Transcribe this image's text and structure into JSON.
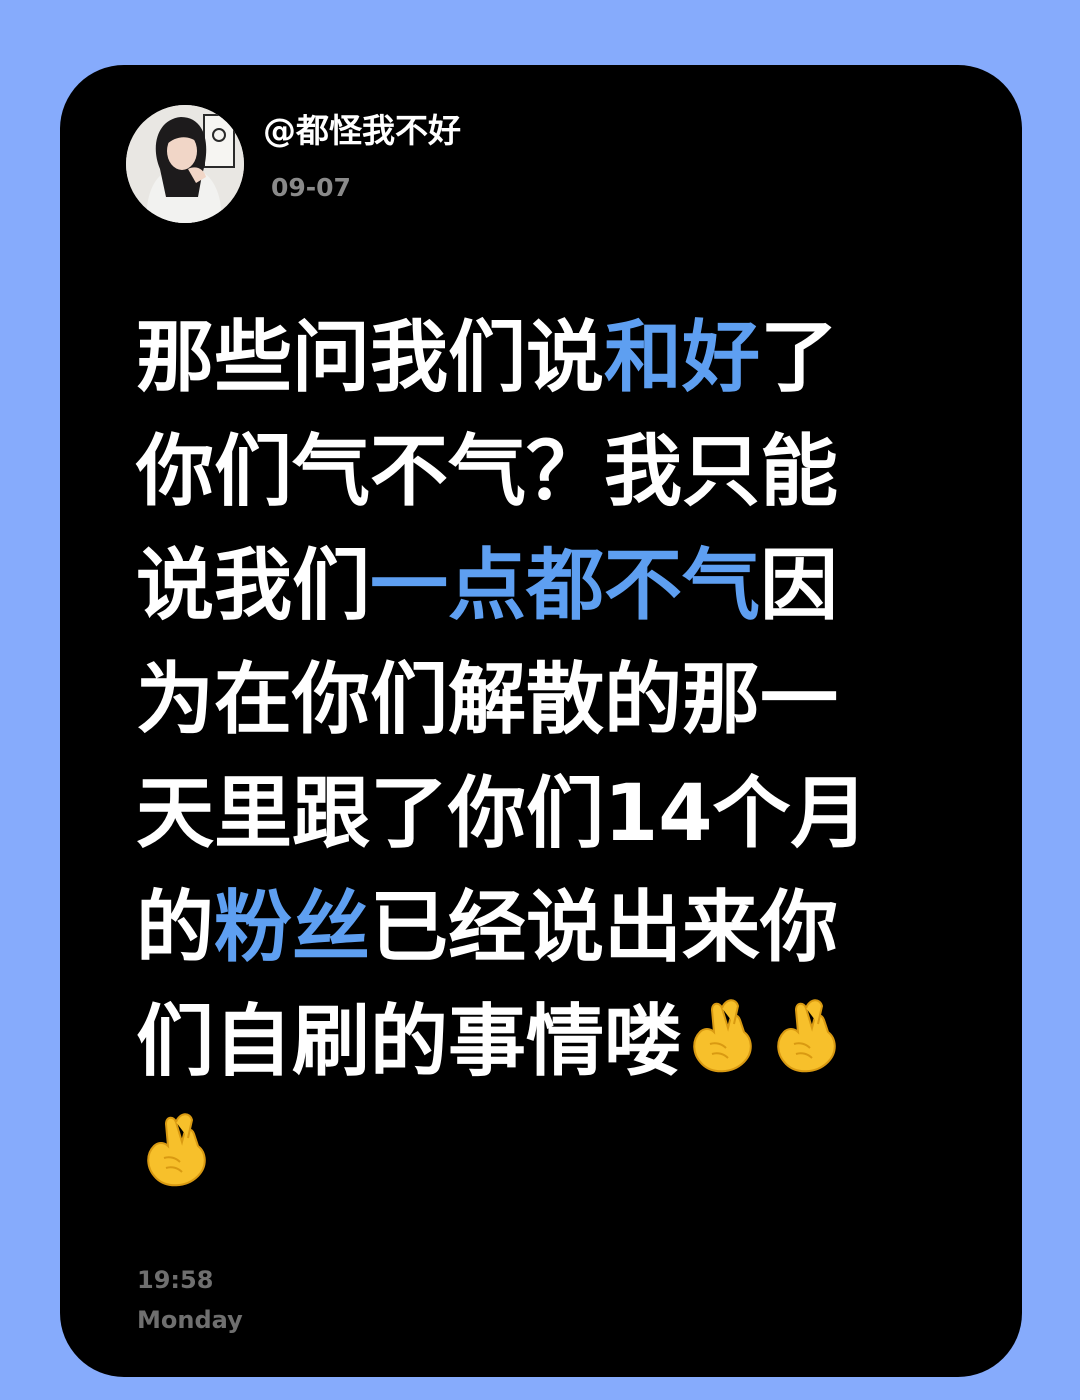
{
  "post": {
    "username": "@都怪我不好",
    "date": "09-07",
    "lines": [
      [
        {
          "text": "那些问我们说"
        },
        {
          "text": "和好",
          "hl": true
        },
        {
          "text": "了"
        }
      ],
      [
        {
          "text": "你们气不气？我只能"
        }
      ],
      [
        {
          "text": "说我们"
        },
        {
          "text": "一点都不气",
          "hl": true
        },
        {
          "text": "因"
        }
      ],
      [
        {
          "text": "为在你们解散的那一"
        }
      ],
      [
        {
          "text": "天里跟了你们14个月"
        }
      ],
      [
        {
          "text": "的"
        },
        {
          "text": "粉丝",
          "hl": true
        },
        {
          "text": "已经说出来你"
        }
      ],
      [
        {
          "text": "们自刷的事情喽"
        },
        {
          "emoji": "pinched-fingers-heart-icon"
        },
        {
          "emoji": "pinched-fingers-heart-icon"
        }
      ],
      [
        {
          "emoji": "pinched-fingers-heart-icon"
        }
      ]
    ]
  },
  "footer": {
    "time": "19:58",
    "day": "Monday"
  },
  "colors": {
    "background": "#86abfc",
    "card": "#000000",
    "text": "#ffffff",
    "highlight": "#5e9ff1",
    "muted": "#6f6f6f",
    "emoji": "#f7c02b"
  }
}
